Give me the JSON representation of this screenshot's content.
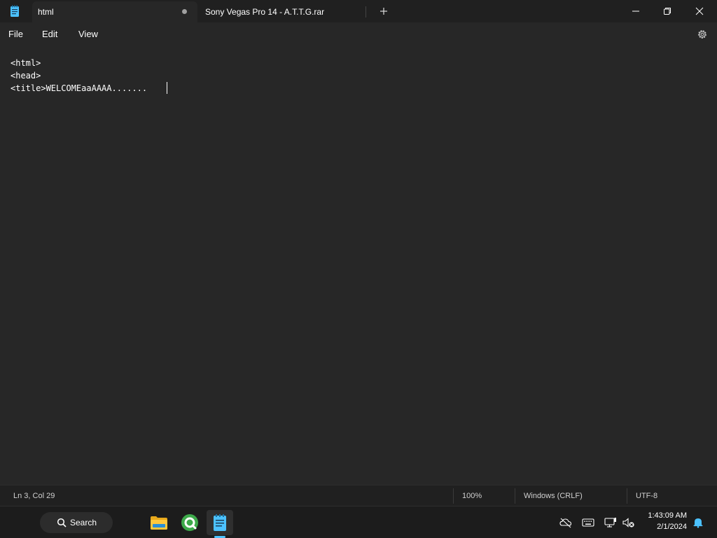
{
  "window": {
    "tabs": [
      {
        "label": "html",
        "active": true,
        "unsaved": true
      },
      {
        "label": "Sony Vegas Pro 14 - A.T.T.G.rar",
        "active": false
      }
    ],
    "new_tab_icon": "plus-icon",
    "controls": [
      "minimize-icon",
      "maximize-icon",
      "close-icon"
    ]
  },
  "menu": {
    "items": [
      "File",
      "Edit",
      "View"
    ],
    "settings_icon": "gear-icon"
  },
  "editor": {
    "lines": [
      "<html>",
      "<head>",
      "<title>WELCOMEaaAAAA......."
    ]
  },
  "status": {
    "position": "Ln 3, Col 29",
    "zoom": "100%",
    "line_ending": "Windows (CRLF)",
    "encoding": "UTF-8"
  },
  "taskbar": {
    "search_label": "Search",
    "apps": [
      "file-explorer-icon",
      "qbittorrent-icon",
      "notepad-icon"
    ],
    "tray": [
      "cloud-off-icon",
      "keyboard-icon",
      "network-icon",
      "volume-muted-icon",
      "bell-icon"
    ],
    "time": "1:43:09 AM",
    "date": "2/1/2024"
  },
  "colors": {
    "accent": "#4cc2ff",
    "background": "#272727",
    "titlebar": "#202020",
    "taskbar": "#1c1c1c"
  }
}
